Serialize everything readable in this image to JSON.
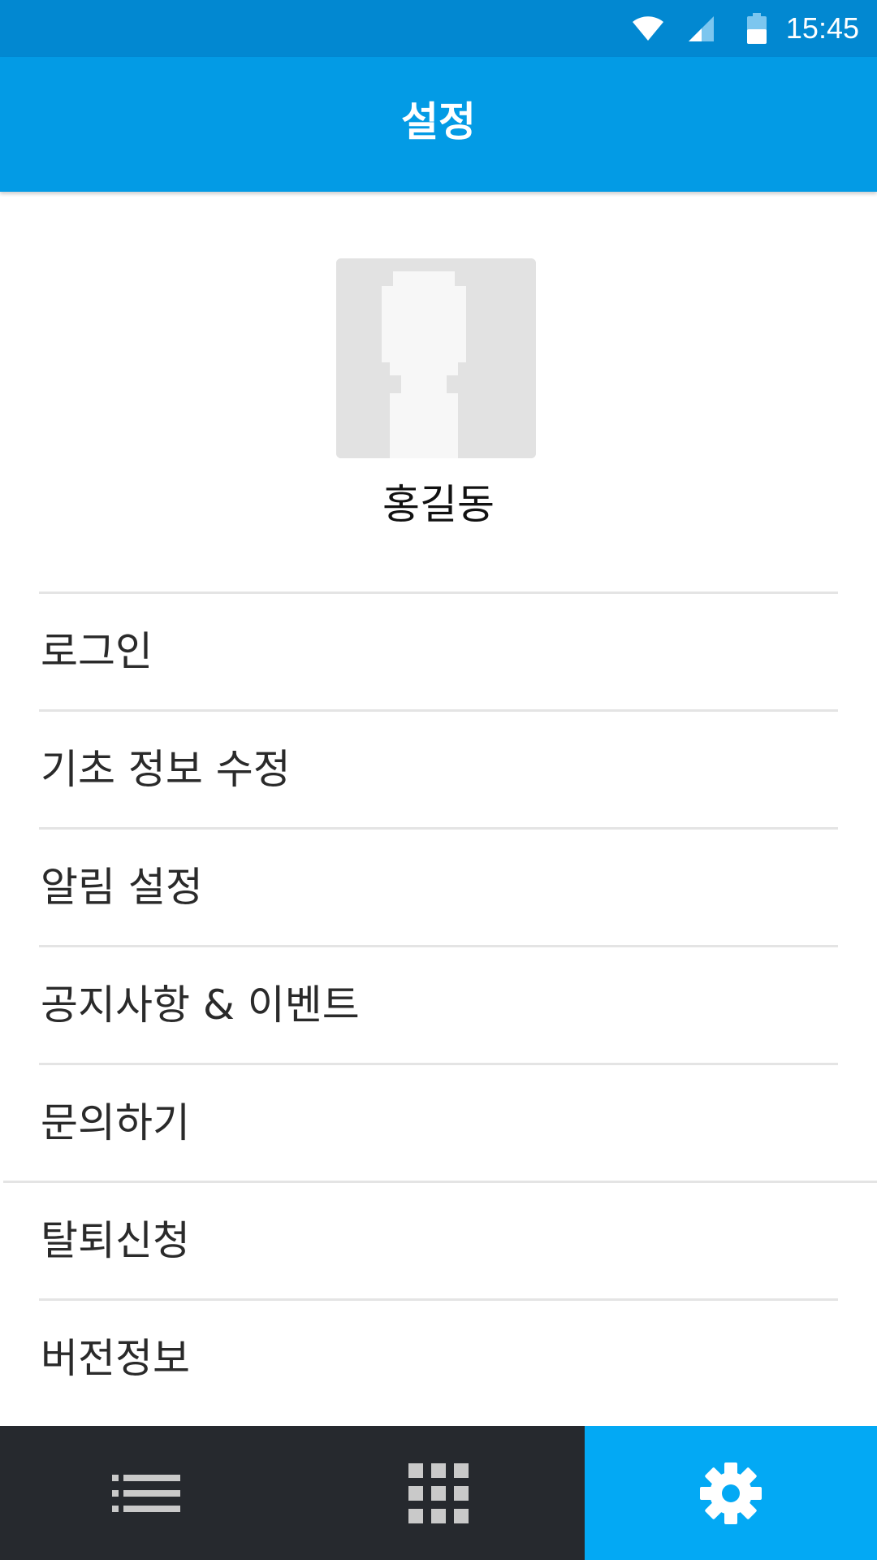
{
  "status_bar": {
    "time": "15:45",
    "icons": [
      "wifi-icon",
      "cellular-signal-icon",
      "battery-icon"
    ]
  },
  "app_bar": {
    "title": "설정"
  },
  "profile": {
    "avatar": "default-avatar-placeholder",
    "name": "홍길동"
  },
  "menu": {
    "items": [
      {
        "label": "로그인"
      },
      {
        "label": "기초 정보 수정"
      },
      {
        "label": "알림 설정"
      },
      {
        "label": "공지사항 & 이벤트"
      },
      {
        "label": "문의하기"
      },
      {
        "label": "탈퇴신청"
      },
      {
        "label": "버전정보"
      }
    ]
  },
  "bottom_nav": {
    "tabs": [
      {
        "icon": "list-icon",
        "active": false
      },
      {
        "icon": "grid-icon",
        "active": false
      },
      {
        "icon": "gear-icon",
        "active": true
      }
    ]
  },
  "colors": {
    "status_bar": "#0288d1",
    "app_bar": "#039be5",
    "active_tab": "#03a9f4",
    "bottom_nav": "#26292e",
    "avatar_bg": "#e2e2e2"
  }
}
